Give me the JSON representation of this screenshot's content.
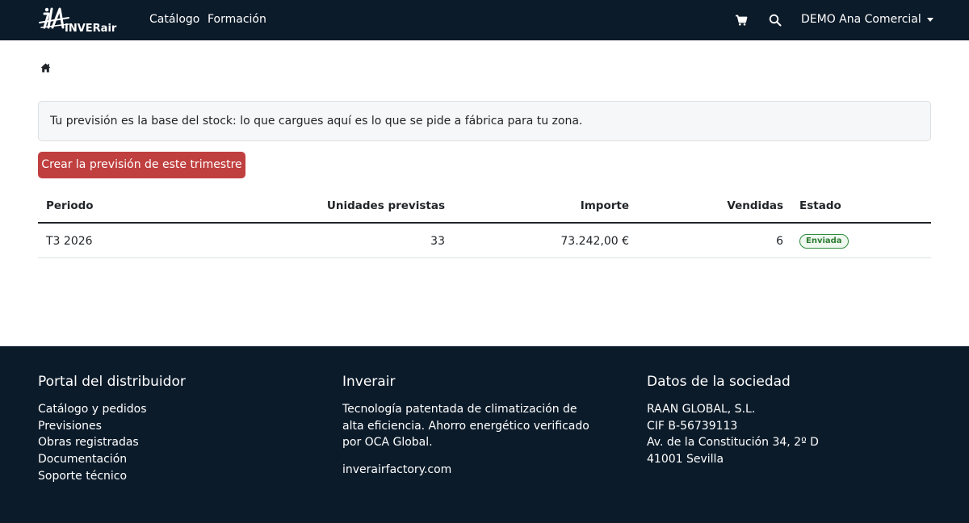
{
  "header": {
    "brand_text": "INVERair",
    "nav": [
      {
        "label": "Catálogo"
      },
      {
        "label": "Formación"
      }
    ],
    "icons": [
      "cart-icon",
      "search-icon"
    ],
    "user_menu": "DEMO Ana Comercial"
  },
  "breadcrumb": {
    "icon": "home-icon"
  },
  "alert": {
    "text": "Tu previsión es la base del stock: lo que cargues aquí es lo que se pide a fábrica para tu zona."
  },
  "actions": {
    "create_label": "Crear la previsión de este trimestre"
  },
  "table": {
    "headers": {
      "periodo": "Periodo",
      "unidades": "Unidades previstas",
      "importe": "Importe",
      "vendidas": "Vendidas",
      "estado": "Estado"
    },
    "rows": [
      {
        "periodo": "T3 2026",
        "unidades": "33",
        "importe": "73.242,00 €",
        "vendidas": "6",
        "estado": "Enviada"
      }
    ]
  },
  "footer": {
    "portal": {
      "title": "Portal del distribuidor",
      "links": [
        "Catálogo y pedidos",
        "Previsiones",
        "Obras registradas",
        "Documentación",
        "Soporte técnico"
      ]
    },
    "inverair": {
      "title": "Inverair",
      "description": "Tecnología patentada de climatización de alta eficiencia. Ahorro energético verificado por OCA Global.",
      "url": "inverairfactory.com"
    },
    "sociedad": {
      "title": "Datos de la sociedad",
      "lines": [
        "RAAN GLOBAL, S.L.",
        "CIF B-56739113",
        "Av. de la Constitución 34, 2º D",
        "41001 Sevilla"
      ]
    }
  },
  "colors": {
    "navbar_bg": "#0c1b2a",
    "primary_button": "#c03f3f",
    "badge_green": "#2e7d32",
    "alert_bg": "#f6f7f8"
  }
}
